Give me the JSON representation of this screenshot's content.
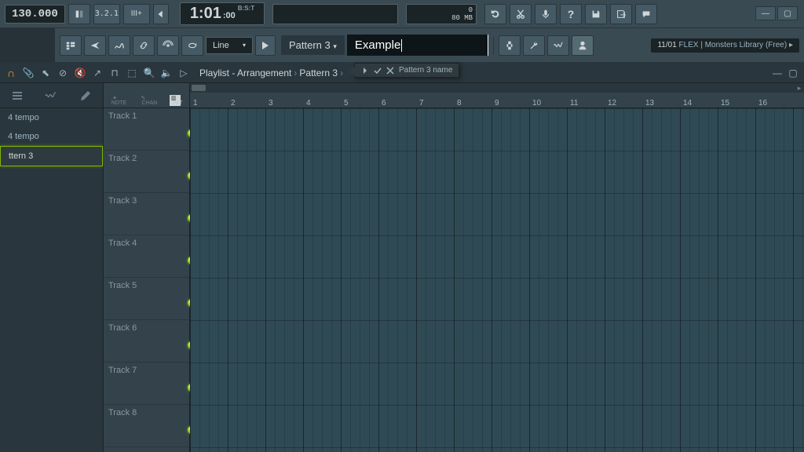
{
  "top": {
    "tempo": "130.000",
    "pat_label": "P",
    "beat_label": "3.2.1",
    "quant_label": "III+",
    "time": "1:01",
    "time_sub": ":00",
    "time_sup": "B:S:T",
    "cpu": "0",
    "mem": "80 MB"
  },
  "toolbar2": {
    "snap_mode": "Line",
    "pattern_label": "Pattern 3",
    "rename_value": "Example",
    "rename_tip": "Pattern 3 name"
  },
  "flex_board": {
    "line1": "11/01",
    "line2": "FLEX | Monsters Library (Free)"
  },
  "playlist_header": {
    "title": "Playlist - Arrangement",
    "crumb2": "Pattern 3"
  },
  "browser": {
    "items": [
      "4 tempo",
      "4 tempo",
      "ttern 3"
    ]
  },
  "tracks": [
    "Track 1",
    "Track 2",
    "Track 3",
    "Track 4",
    "Track 5",
    "Track 6",
    "Track 7",
    "Track 8"
  ],
  "ruler_bars": [
    1,
    2,
    3,
    4,
    5,
    6,
    7,
    8,
    9,
    10,
    11,
    12,
    13,
    14,
    15,
    16
  ],
  "track_head_labels": [
    "NOTE",
    "CHAN",
    "PAT"
  ],
  "icons": {
    "metronome": "metronome-icon",
    "wait": "hourglass-icon",
    "countdown": "count-icon",
    "overdub": "overdub-icon",
    "undo": "undo-icon",
    "cut": "scissors-icon",
    "mic": "mic-icon",
    "help": "help-icon",
    "save": "save-icon",
    "export": "export-icon",
    "msg": "message-icon",
    "pattern": "pattern-icon",
    "send": "send-arrow-icon",
    "automation": "automation-icon",
    "link": "link-icon",
    "record": "record-icon",
    "loop": "loop-icon",
    "play": "play-icon",
    "plug": "plug-icon",
    "wrench": "wrench-icon",
    "wave": "wave-icon",
    "user": "user-icon",
    "browser1": "list-icon",
    "browser2": "wave-icon",
    "browser3": "pencil-icon"
  }
}
